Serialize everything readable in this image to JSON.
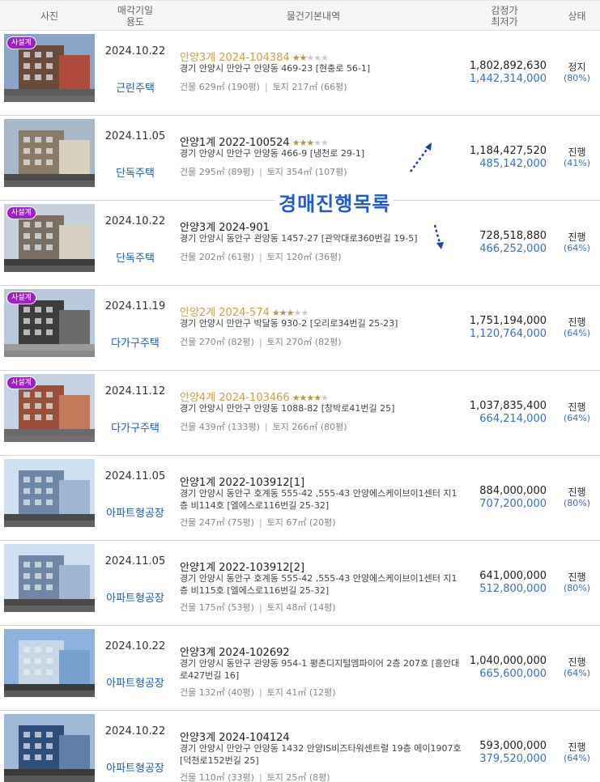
{
  "header": {
    "photo": "사진",
    "date_line1": "매각기일",
    "date_line2": "용도",
    "info": "물건기본내역",
    "price_line1": "감정가",
    "price_line2": "최저가",
    "status": "상태"
  },
  "overlay_text": "경매진행목록",
  "rows": [
    {
      "badge": "사설계",
      "date": "2024.10.22",
      "use": "근린주택",
      "title": "안양3계 2024-104384",
      "featured": true,
      "stars_on": "★★",
      "stars_off": "★★★",
      "address": "경기 안양시 만안구 안양동 469-23 [현충로 56-1]",
      "building": "건물 629㎡ (190평)",
      "land": "토지 217㎡ (66평)",
      "appraisal": "1,802,892,630",
      "minimum": "1,442,314,000",
      "status": "정지",
      "percent": "(80%)"
    },
    {
      "badge": "",
      "date": "2024.11.05",
      "use": "단독주택",
      "title": "안양1계 2022-100524",
      "featured": false,
      "stars_on": "★★★",
      "stars_off": "★★",
      "address": "경기 안양시 만안구 안양동 466-9 [냉천로 29-1]",
      "building": "건물 295㎡ (89평)",
      "land": "토지 354㎡ (107평)",
      "appraisal": "1,184,427,520",
      "minimum": "485,142,000",
      "status": "진행",
      "percent": "(41%)"
    },
    {
      "badge": "사설계",
      "date": "2024.10.22",
      "use": "단독주택",
      "title": "안양3계 2024-901",
      "featured": false,
      "stars_on": "",
      "stars_off": "",
      "address": "경기 안양시 동안구 관양동 1457-27 [관악대로360번길 19-5]",
      "building": "건물 202㎡ (61평)",
      "land": "토지 120㎡ (36평)",
      "appraisal": "728,518,880",
      "minimum": "466,252,000",
      "status": "진행",
      "percent": "(64%)"
    },
    {
      "badge": "사설계",
      "date": "2024.11.19",
      "use": "다가구주택",
      "title": "안양2계 2024-574",
      "featured": true,
      "stars_on": "★★★",
      "stars_off": "★★",
      "address": "경기 안양시 만안구 박달동 930-2 [오리로34번길 25-23]",
      "building": "건물 270㎡ (82평)",
      "land": "토지 270㎡ (82평)",
      "appraisal": "1,751,194,000",
      "minimum": "1,120,764,000",
      "status": "진행",
      "percent": "(64%)"
    },
    {
      "badge": "사설계",
      "date": "2024.11.12",
      "use": "다가구주택",
      "title": "안양4계 2024-103466",
      "featured": true,
      "stars_on": "★★★★",
      "stars_off": "★",
      "address": "경기 안양시 만안구 안양동 1088-82 [창박로41번길 25]",
      "building": "건물 439㎡ (133평)",
      "land": "토지 266㎡ (80평)",
      "appraisal": "1,037,835,400",
      "minimum": "664,214,000",
      "status": "진행",
      "percent": "(64%)"
    },
    {
      "badge": "",
      "date": "2024.11.05",
      "use": "아파트형공장",
      "title": "안양1계 2022-103912[1]",
      "featured": false,
      "stars_on": "",
      "stars_off": "",
      "address": "경기 안양시 동안구 호계동 555-42 ,555-43 안양에스케이브이1센터 지1층 비114호 [엘에스로116번길 25-32]",
      "building": "건물 247㎡ (75평)",
      "land": "토지 67㎡ (20평)",
      "appraisal": "884,000,000",
      "minimum": "707,200,000",
      "status": "진행",
      "percent": "(80%)"
    },
    {
      "badge": "",
      "date": "2024.11.05",
      "use": "아파트형공장",
      "title": "안양1계 2022-103912[2]",
      "featured": false,
      "stars_on": "",
      "stars_off": "",
      "address": "경기 안양시 동안구 호계동 555-42 ,555-43 안양에스케이브이1센터 지1층 비115호 [엘에스로116번길 25-32]",
      "building": "건물 175㎡ (53평)",
      "land": "토지 48㎡ (14평)",
      "appraisal": "641,000,000",
      "minimum": "512,800,000",
      "status": "진행",
      "percent": "(80%)"
    },
    {
      "badge": "",
      "date": "2024.10.22",
      "use": "아파트형공장",
      "title": "안양3계 2024-102692",
      "featured": false,
      "stars_on": "",
      "stars_off": "",
      "address": "경기 안양시 동안구 관양동 954-1 평촌디지털엠파이어 2층 207호 [흥안대로427번길 16]",
      "building": "건물 132㎡ (40평)",
      "land": "토지 41㎡ (12평)",
      "appraisal": "1,040,000,000",
      "minimum": "665,600,000",
      "status": "진행",
      "percent": "(64%)"
    },
    {
      "badge": "",
      "date": "2024.10.22",
      "use": "아파트형공장",
      "title": "안양3계 2024-104124",
      "featured": false,
      "stars_on": "",
      "stars_off": "",
      "address": "경기 안양시 만안구 안양동 1432 안양IS비즈타워센트럴 19층 에이1907호 [덕천로152번길 25]",
      "building": "건물 110㎡ (33평)",
      "land": "토지 25㎡ (8평)",
      "appraisal": "593,000,000",
      "minimum": "379,520,000",
      "status": "진행",
      "percent": "(64%)"
    }
  ]
}
